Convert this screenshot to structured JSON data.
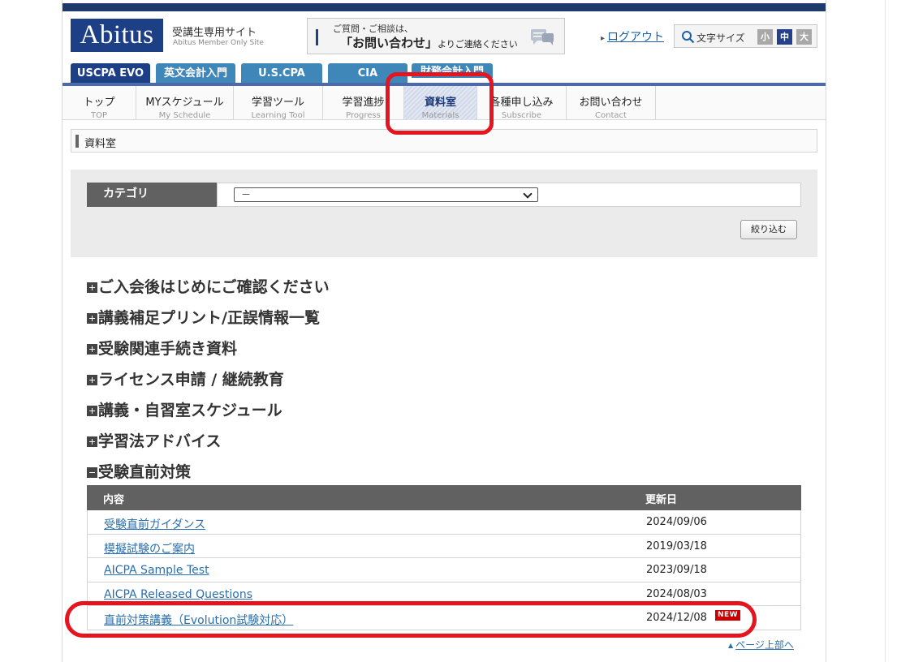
{
  "header": {
    "logo": "Abitus",
    "site_title": "受講生専用サイト",
    "site_subtitle": "Abitus Member Only Site",
    "contact_line1": "ご質問・ご相談は、",
    "contact_line2_bold": "「お問い合わせ」",
    "contact_line2_rest": "よりご連絡ください",
    "logout": "ログアウト",
    "font_size_label": "文字サイズ",
    "font_small": "小",
    "font_medium": "中",
    "font_large": "大"
  },
  "tabs": [
    "USCPA EVO",
    "英文会計入門",
    "U.S.CPA",
    "CIA",
    "財務会計入門"
  ],
  "nav": [
    {
      "jp": "トップ",
      "en": "TOP"
    },
    {
      "jp": "MYスケジュール",
      "en": "My Schedule"
    },
    {
      "jp": "学習ツール",
      "en": "Learning Tool"
    },
    {
      "jp": "学習進捗",
      "en": "Progress"
    },
    {
      "jp": "資料室",
      "en": "Materials"
    },
    {
      "jp": "各種申し込み",
      "en": "Subscribe"
    },
    {
      "jp": "お問い合わせ",
      "en": "Contact"
    }
  ],
  "breadcrumb": "資料室",
  "filter": {
    "category_label": "カテゴリ",
    "category_value": "－",
    "submit": "絞り込む"
  },
  "sections": [
    "ご入会後はじめにご確認ください",
    "講義補足プリント/正誤情報一覧",
    "受験関連手続き資料",
    "ライセンス申請 / 継続教育",
    "講義・自習室スケジュール",
    "学習法アドバイス",
    "受験直前対策"
  ],
  "table": {
    "col_content": "内容",
    "col_updated": "更新日",
    "rows": [
      {
        "title": "受験直前ガイダンス",
        "date": "2024/09/06"
      },
      {
        "title": "模擬試験のご案内",
        "date": "2019/03/18"
      },
      {
        "title": "AICPA Sample Test",
        "date": "2023/09/18"
      },
      {
        "title": "AICPA Released Questions",
        "date": "2024/08/03"
      },
      {
        "title": "直前対策講義（Evolution試験対応）",
        "date": "2024/12/08",
        "badge": "NEW"
      }
    ]
  },
  "page_top": "ページ上部へ",
  "colors": {
    "brand_navy": "#1d3f86",
    "tab_blue": "#3f86b9",
    "link": "#2a6fb0",
    "annotation_red": "#e4151f",
    "new_badge": "#cc0000"
  }
}
